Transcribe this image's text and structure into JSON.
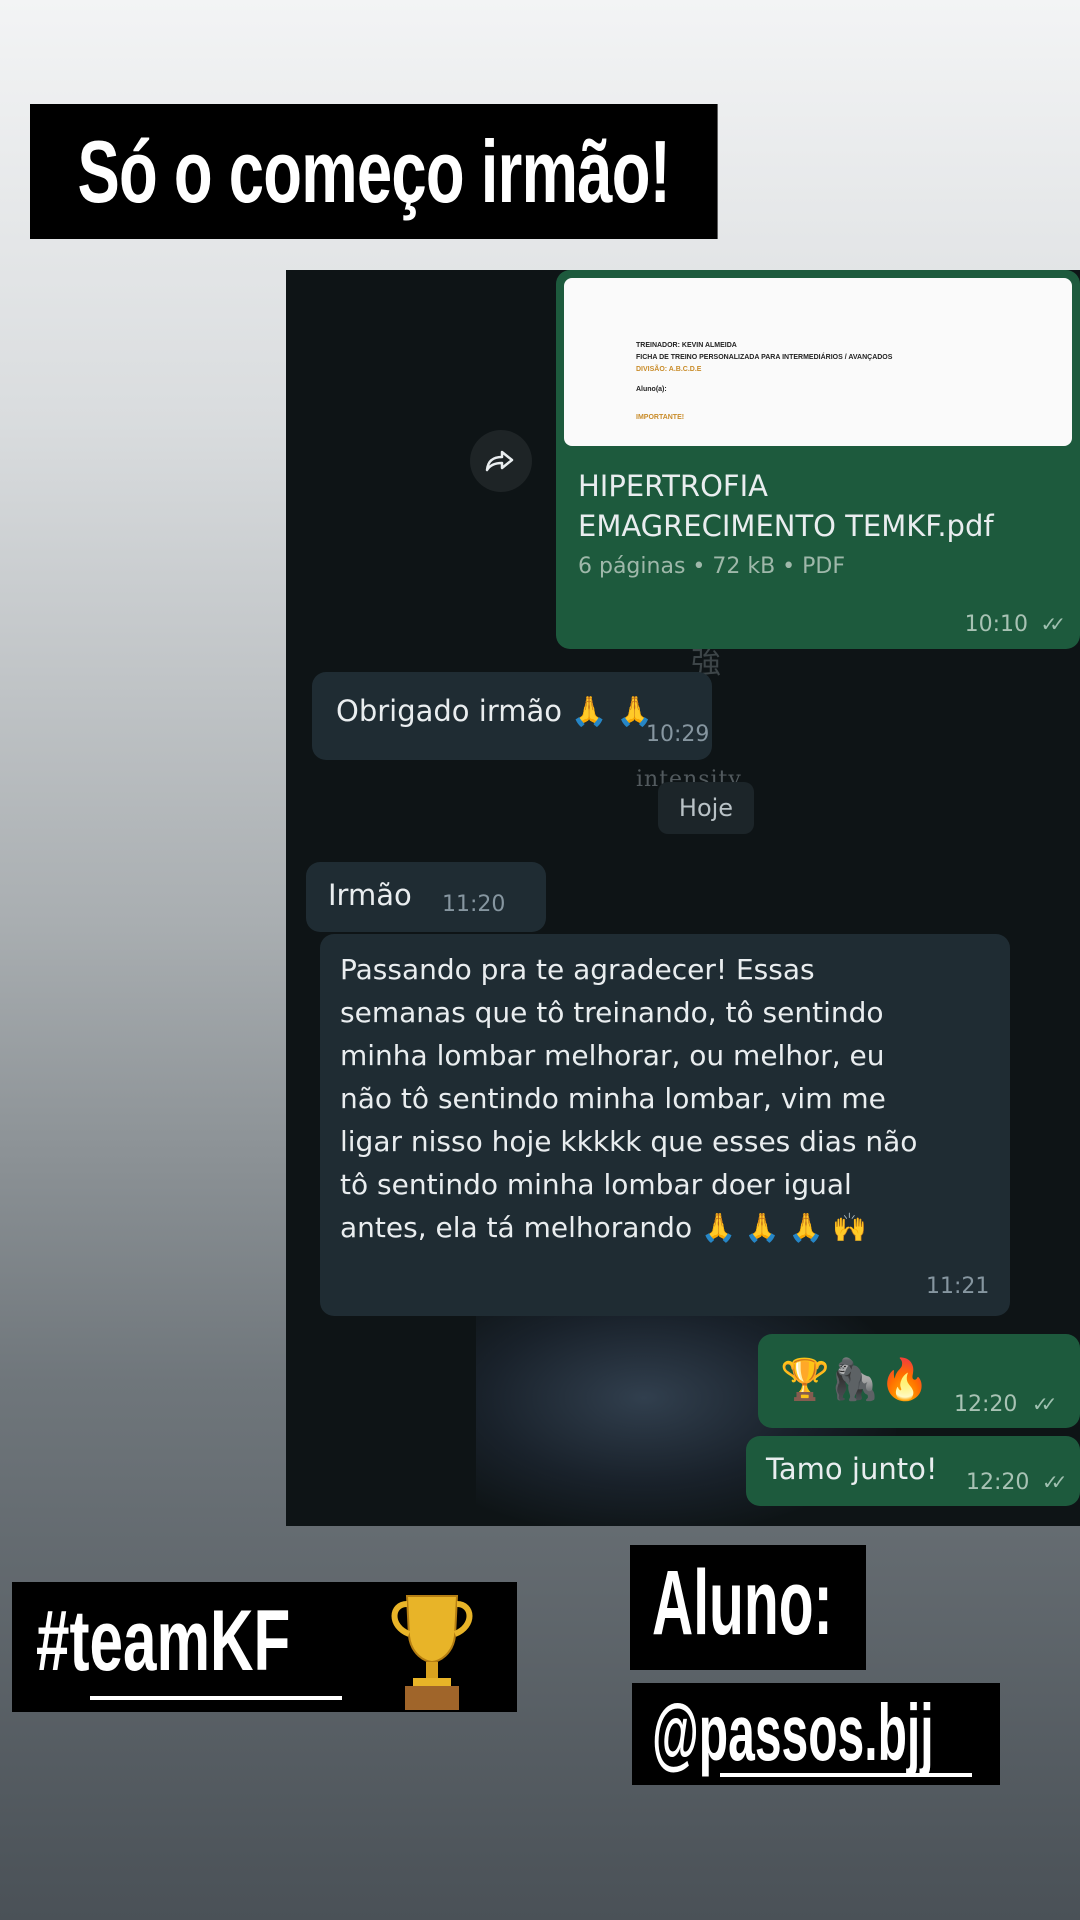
{
  "headline": "Só o começo irmão!",
  "chat": {
    "document": {
      "preview_lines": [
        "TREINADOR: KEVIN ALMEIDA",
        "FICHA DE TREINO PERSONALIZADA PARA INTERMEDIÁRIOS / AVANÇADOS",
        "DIVISÃO: A.B.C.D.E",
        "Aluno(a):",
        "IMPORTANTE!"
      ],
      "name": "HIPERTROFIA\nEMAGRECIMENTO TEMKF.pdf",
      "meta": "6 páginas • 72 kB • PDF",
      "time": "10:10",
      "forward_icon": "forward-arrow-icon"
    },
    "msg1": {
      "text": "Obrigado irmão 🙏 🙏",
      "time": "10:29"
    },
    "background_text": "intensity.",
    "date_chip": "Hoje",
    "msg2": {
      "text": "Irmão",
      "time": "11:20"
    },
    "msg3": {
      "text": "Passando pra te agradecer! Essas\nsemanas que tô treinando, tô sentindo\nminha lombar melhorar, ou melhor, eu\nnão tô sentindo minha lombar, vim me\nligar nisso hoje kkkkk que esses dias não\ntô sentindo minha lombar doer igual\nantes, ela tá melhorando 🙏 🙏 🙏 🙌",
      "time": "11:21"
    },
    "msg4": {
      "text": "🏆🦍🔥",
      "time": "12:20"
    },
    "msg5": {
      "text": "Tamo junto!",
      "time": "12:20"
    }
  },
  "hashtag": "#teamKF",
  "aluno_label": "Aluno:",
  "handle": "@passos.bjj",
  "colors": {
    "chat_bg": "#0e1416",
    "incoming_bubble": "#1f2c33",
    "outgoing_bubble": "#1d5a3d",
    "label_bg": "#000000"
  }
}
